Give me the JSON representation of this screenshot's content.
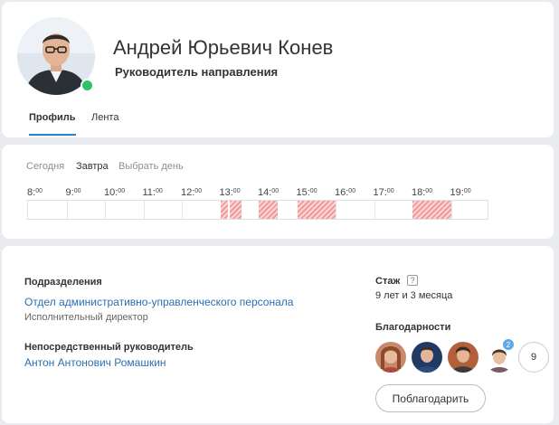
{
  "profile": {
    "name": "Андрей Юрьевич Конев",
    "position": "Руководитель направления",
    "status_color": "#2fc26b"
  },
  "tabs": [
    {
      "label": "Профиль",
      "active": true
    },
    {
      "label": "Лента",
      "active": false
    }
  ],
  "schedule": {
    "day_options": [
      {
        "label": "Сегодня",
        "active": false
      },
      {
        "label": "Завтра",
        "active": true
      },
      {
        "label": "Выбрать день",
        "active": false
      }
    ],
    "hours": [
      {
        "h": "8",
        "m": "00"
      },
      {
        "h": "9",
        "m": "00"
      },
      {
        "h": "10",
        "m": "00"
      },
      {
        "h": "11",
        "m": "00"
      },
      {
        "h": "12",
        "m": "00"
      },
      {
        "h": "13",
        "m": "00"
      },
      {
        "h": "14",
        "m": "00"
      },
      {
        "h": "15",
        "m": "00"
      },
      {
        "h": "16",
        "m": "00"
      },
      {
        "h": "17",
        "m": "00"
      },
      {
        "h": "18",
        "m": "00"
      },
      {
        "h": "19",
        "m": "00"
      }
    ],
    "busy_slots": [
      {
        "start": 13.0,
        "end": 13.2
      },
      {
        "start": 13.25,
        "end": 13.55
      },
      {
        "start": 14.0,
        "end": 14.5
      },
      {
        "start": 15.0,
        "end": 16.0
      },
      {
        "start": 18.0,
        "end": 19.0
      }
    ],
    "busy_color": "#f19a9a"
  },
  "info": {
    "departments_label": "Подразделения",
    "department": "Отдел административно-управленческого персонала",
    "job_title": "Исполнительный директор",
    "manager_label": "Непосредственный руководитель",
    "manager": "Антон Антонович Ромашкин",
    "experience_label": "Стаж",
    "experience": "9 лет и 3 месяца",
    "thanks_label": "Благодарности",
    "thanks_badge": "2",
    "thanks_more": "9",
    "thank_button": "Поблагодарить"
  },
  "colors": {
    "link": "#2a6fb3",
    "accent": "#2f80d0",
    "badge": "#5fa8ea"
  },
  "icons": [
    "help-icon"
  ]
}
